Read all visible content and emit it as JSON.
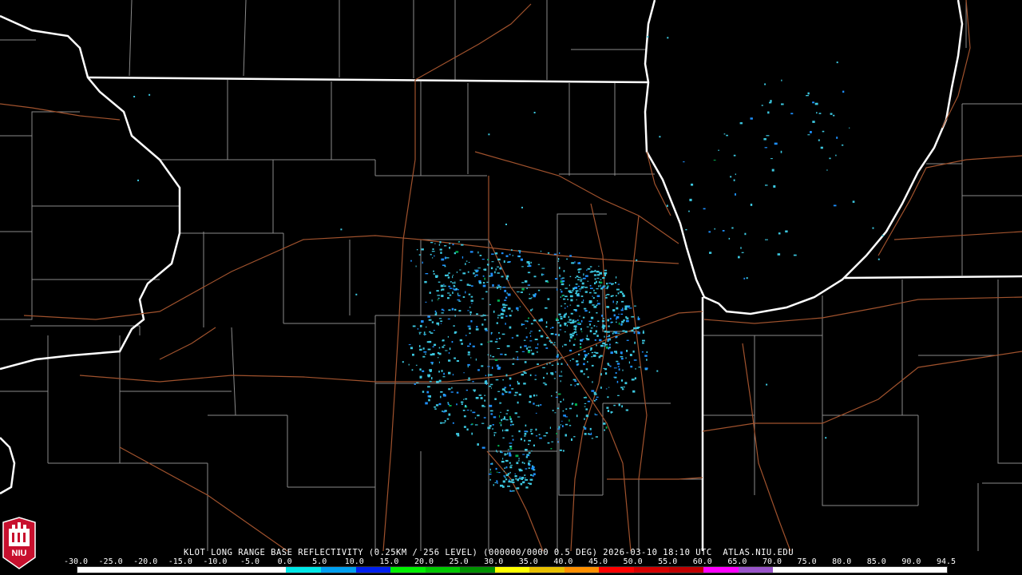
{
  "caption": {
    "product": "KLOT LONG RANGE BASE REFLECTIVITY (0.25KM / 256 LEVEL) (000000/0000 0.5 DEG)",
    "timestamp": "2026-03-10 18:10 UTC",
    "source": "ATLAS.NIU.EDU"
  },
  "colorbar": {
    "labels": [
      "-30.0",
      "-25.0",
      "-20.0",
      "-15.0",
      "-10.0",
      "-5.0",
      "0.0",
      "5.0",
      "10.0",
      "15.0",
      "20.0",
      "25.0",
      "30.0",
      "35.0",
      "40.0",
      "45.0",
      "50.0",
      "55.0",
      "60.0",
      "65.0",
      "70.0",
      "75.0",
      "80.0",
      "85.0",
      "90.0",
      "94.5"
    ],
    "colors": [
      "#ffffff",
      "#ffffff",
      "#ffffff",
      "#ffffff",
      "#ffffff",
      "#ffffff",
      "#00e8e8",
      "#00a0f0",
      "#0020f0",
      "#00f000",
      "#00c800",
      "#009000",
      "#ffff00",
      "#e8c000",
      "#ff9000",
      "#ff0000",
      "#d60000",
      "#c00000",
      "#ff00ff",
      "#9955c9",
      "#ffffff",
      "#ffffff",
      "#ffffff",
      "#ffffff",
      "#ffffff"
    ]
  },
  "logo": {
    "text": "NIU"
  },
  "palette": {
    "background": "#000000",
    "county_lines": "#8a8a8a",
    "state_lines": "#ffffff",
    "roads": "#a0522d",
    "echo_light": "#3cc8e0",
    "echo_medium": "#1e90ff",
    "echo_strong": "#00b050"
  }
}
